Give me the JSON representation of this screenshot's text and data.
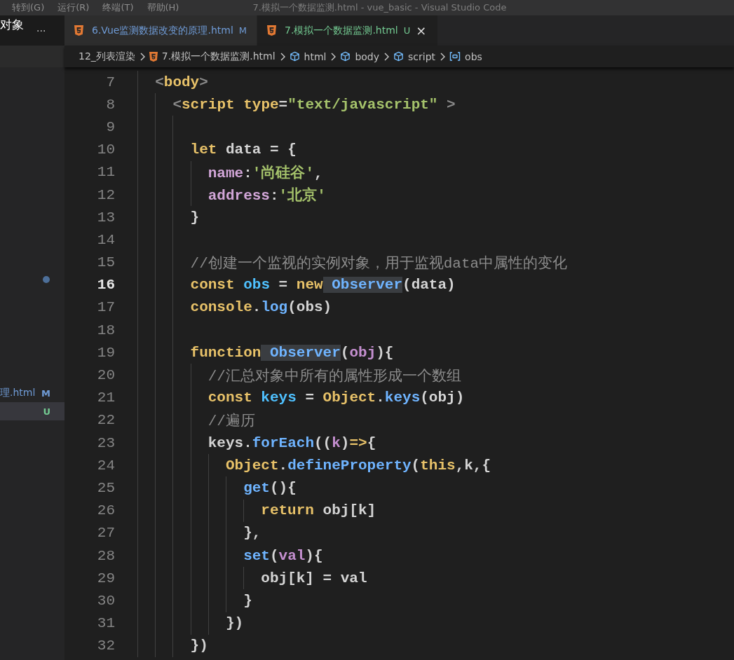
{
  "title_bar": {
    "menu": [
      "转到(G)",
      "运行(R)",
      "终端(T)",
      "帮助(H)"
    ],
    "title": "7.模拟一个数据监测.html - vue_basic - Visual Studio Code"
  },
  "sidebar": {
    "header": "对象",
    "more": "···",
    "items": [
      {
        "label": "理.html",
        "status": "M",
        "kind": "modified",
        "selected": false
      },
      {
        "status": "U",
        "kind": "untracked",
        "selected": true
      }
    ]
  },
  "tabs": [
    {
      "label": "6.Vue监测数据改变的原理.html",
      "status": "M",
      "kind": "modified",
      "selected": false
    },
    {
      "label": "7.模拟一个数据监测.html",
      "status": "U",
      "kind": "untracked",
      "selected": true,
      "close": "×"
    }
  ],
  "breadcrumb": [
    {
      "kind": "folder",
      "label": "12_列表渲染"
    },
    {
      "kind": "file",
      "label": "7.模拟一个数据监测.html"
    },
    {
      "kind": "element",
      "label": "html"
    },
    {
      "kind": "element",
      "label": "body"
    },
    {
      "kind": "element",
      "label": "script"
    },
    {
      "kind": "variable",
      "label": "obs"
    }
  ],
  "code": [
    {
      "number": "7",
      "current": false,
      "tokens": [
        {
          "kind": "punct",
          "text": "<"
        },
        {
          "kind": "tag",
          "text": "body"
        },
        {
          "kind": "punct",
          "text": ">"
        }
      ],
      "children": [
        {
          "number": "8",
          "current": false,
          "tokens": [
            {
              "kind": "punct",
              "text": "<"
            },
            {
              "kind": "tag",
              "text": "script type"
            },
            {
              "kind": "plain",
              "text": "="
            },
            {
              "kind": "string",
              "text": "\"text/javascript\""
            },
            {
              "kind": "punct",
              "text": " >"
            }
          ],
          "children": [
            {
              "number": "9",
              "current": false
            },
            {
              "number": "10",
              "current": false,
              "tokens": [
                {
                  "kind": "keyword",
                  "text": "let"
                },
                {
                  "kind": "plain",
                  "text": " data = {"
                }
              ],
              "children": [
                {
                  "number": "11",
                  "current": false,
                  "tokens": [
                    {
                      "kind": "property",
                      "text": "name"
                    },
                    {
                      "kind": "plain",
                      "text": ":"
                    },
                    {
                      "kind": "string",
                      "text": "'尚硅谷'"
                    },
                    {
                      "kind": "plain",
                      "text": ","
                    }
                  ]
                },
                {
                  "number": "12",
                  "current": false,
                  "tokens": [
                    {
                      "kind": "property",
                      "text": "address"
                    },
                    {
                      "kind": "plain",
                      "text": ":"
                    },
                    {
                      "kind": "string",
                      "text": "'北京'"
                    }
                  ]
                }
              ]
            },
            {
              "number": "13",
              "current": false,
              "tokens": [
                {
                  "kind": "plain",
                  "text": "}"
                }
              ]
            },
            {
              "number": "14",
              "current": false
            },
            {
              "number": "15",
              "current": false,
              "tokens": [
                {
                  "kind": "comment",
                  "text": "//创建一个监视的实例对象，用于监视data中属性的变化"
                }
              ]
            },
            {
              "number": "16",
              "current": true,
              "tokens": [
                {
                  "kind": "keyword",
                  "text": "const"
                },
                {
                  "kind": "constant",
                  "text": " obs"
                },
                {
                  "kind": "plain",
                  "text": " = "
                },
                {
                  "kind": "keyword",
                  "text": "new"
                },
                {
                  "kind": "highlight",
                  "text": " Observer"
                },
                {
                  "kind": "plain",
                  "text": "(data)"
                }
              ]
            },
            {
              "number": "17",
              "current": false,
              "tokens": [
                {
                  "kind": "object",
                  "text": "console"
                },
                {
                  "kind": "plain",
                  "text": "."
                },
                {
                  "kind": "method",
                  "text": "log"
                },
                {
                  "kind": "plain",
                  "text": "(obs)"
                }
              ]
            },
            {
              "number": "18",
              "current": false
            },
            {
              "number": "19",
              "current": false,
              "tokens": [
                {
                  "kind": "keyword",
                  "text": "function"
                },
                {
                  "kind": "highlight",
                  "text": " Observer"
                },
                {
                  "kind": "plain",
                  "text": "("
                },
                {
                  "kind": "param",
                  "text": "obj"
                },
                {
                  "kind": "plain",
                  "text": "){"
                }
              ],
              "children": [
                {
                  "number": "20",
                  "current": false,
                  "tokens": [
                    {
                      "kind": "comment",
                      "text": "//汇总对象中所有的属性形成一个数组"
                    }
                  ]
                },
                {
                  "number": "21",
                  "current": false,
                  "tokens": [
                    {
                      "kind": "keyword",
                      "text": "const"
                    },
                    {
                      "kind": "constant",
                      "text": " keys"
                    },
                    {
                      "kind": "plain",
                      "text": " = "
                    },
                    {
                      "kind": "object",
                      "text": "Object"
                    },
                    {
                      "kind": "plain",
                      "text": "."
                    },
                    {
                      "kind": "method",
                      "text": "keys"
                    },
                    {
                      "kind": "plain",
                      "text": "(obj)"
                    }
                  ]
                },
                {
                  "number": "22",
                  "current": false,
                  "tokens": [
                    {
                      "kind": "comment",
                      "text": "//遍历"
                    }
                  ]
                },
                {
                  "number": "23",
                  "current": false,
                  "tokens": [
                    {
                      "kind": "plain",
                      "text": "keys."
                    },
                    {
                      "kind": "method",
                      "text": "forEach"
                    },
                    {
                      "kind": "plain",
                      "text": "(("
                    },
                    {
                      "kind": "param",
                      "text": "k"
                    },
                    {
                      "kind": "plain",
                      "text": ")"
                    },
                    {
                      "kind": "keyword",
                      "text": "=>"
                    },
                    {
                      "kind": "plain",
                      "text": "{"
                    }
                  ],
                  "children": [
                    {
                      "number": "24",
                      "current": false,
                      "tokens": [
                        {
                          "kind": "object",
                          "text": "Object"
                        },
                        {
                          "kind": "plain",
                          "text": "."
                        },
                        {
                          "kind": "method",
                          "text": "defineProperty"
                        },
                        {
                          "kind": "plain",
                          "text": "("
                        },
                        {
                          "kind": "keyword",
                          "text": "this"
                        },
                        {
                          "kind": "plain",
                          "text": ",k,{"
                        }
                      ],
                      "children": [
                        {
                          "number": "25",
                          "current": false,
                          "tokens": [
                            {
                              "kind": "method",
                              "text": "get"
                            },
                            {
                              "kind": "plain",
                              "text": "(){"
                            }
                          ],
                          "children": [
                            {
                              "number": "26",
                              "current": false,
                              "tokens": [
                                {
                                  "kind": "keyword",
                                  "text": "return"
                                },
                                {
                                  "kind": "plain",
                                  "text": " obj[k]"
                                }
                              ]
                            }
                          ]
                        },
                        {
                          "number": "27",
                          "current": false,
                          "tokens": [
                            {
                              "kind": "plain",
                              "text": "},"
                            }
                          ]
                        },
                        {
                          "number": "28",
                          "current": false,
                          "tokens": [
                            {
                              "kind": "method",
                              "text": "set"
                            },
                            {
                              "kind": "plain",
                              "text": "("
                            },
                            {
                              "kind": "param",
                              "text": "val"
                            },
                            {
                              "kind": "plain",
                              "text": "){"
                            }
                          ],
                          "children": [
                            {
                              "number": "29",
                              "current": false,
                              "tokens": [
                                {
                                  "kind": "plain",
                                  "text": "obj[k] = val"
                                }
                              ]
                            }
                          ]
                        },
                        {
                          "number": "30",
                          "current": false,
                          "tokens": [
                            {
                              "kind": "plain",
                              "text": "}"
                            }
                          ]
                        }
                      ]
                    },
                    {
                      "number": "31",
                      "current": false,
                      "tokens": [
                        {
                          "kind": "plain",
                          "text": "})"
                        }
                      ]
                    }
                  ]
                }
              ]
            },
            {
              "number": "32",
              "current": false,
              "tokens": [
                {
                  "kind": "plain",
                  "text": "})"
                }
              ]
            }
          ]
        }
      ]
    }
  ]
}
